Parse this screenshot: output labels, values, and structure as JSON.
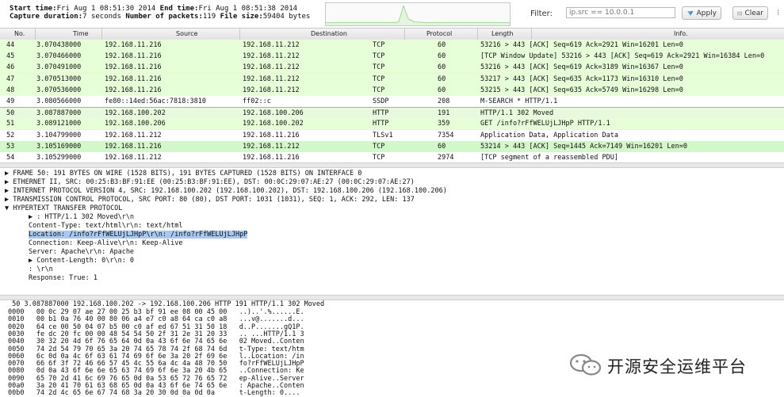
{
  "capture": {
    "start_label": "Start time:",
    "start_value": "Fri Aug  1 08:51:30 2014",
    "end_label": "End time:",
    "end_value": "Fri Aug  1 08:51:38 2014",
    "duration_label": "Capture duration:",
    "duration_value": "7 seconds",
    "packets_label": "Number of packets:",
    "packets_value": "119",
    "filesize_label": "File size:",
    "filesize_value": "59404 bytes"
  },
  "filter": {
    "label": "Filter:",
    "placeholder": "ip.src == 10.0.0.1",
    "apply_label": "Apply",
    "clear_label": "Clear"
  },
  "columns": [
    "No.",
    "Time",
    "Source",
    "Destination",
    "Protocol",
    "Length",
    "Info."
  ],
  "packets": [
    {
      "no": "44",
      "time": "3.070438000",
      "src": "192.168.11.216",
      "dst": "192.168.11.212",
      "proto": "TCP",
      "len": "60",
      "info": "53216 > 443 [ACK] Seq=619 Ack=2921 Win=16201 Len=0",
      "style": "green"
    },
    {
      "no": "45",
      "time": "3.070466000",
      "src": "192.168.11.216",
      "dst": "192.168.11.212",
      "proto": "TCP",
      "len": "60",
      "info": "[TCP Window Update] 53216 > 443 [ACK] Seq=619 Ack=2921 Win=16384 Len=0",
      "style": "green"
    },
    {
      "no": "46",
      "time": "3.070491000",
      "src": "192.168.11.216",
      "dst": "192.168.11.212",
      "proto": "TCP",
      "len": "60",
      "info": "53216 > 443 [ACK] Seq=619 Ack=3189 Win=16367 Len=0",
      "style": "green"
    },
    {
      "no": "47",
      "time": "3.070513000",
      "src": "192.168.11.216",
      "dst": "192.168.11.212",
      "proto": "TCP",
      "len": "60",
      "info": "53217 > 443 [ACK] Seq=635 Ack=1173 Win=16310 Len=0",
      "style": "green"
    },
    {
      "no": "48",
      "time": "3.070536000",
      "src": "192.168.11.216",
      "dst": "192.168.11.212",
      "proto": "TCP",
      "len": "60",
      "info": "53215 > 443 [ACK] Seq=635 Ack=5749 Win=16298 Len=0",
      "style": "green"
    },
    {
      "no": "49",
      "time": "3.080566000",
      "src": "fe80::14ed:56ac:7818:3810",
      "dst": "ff02::c",
      "proto": "SSDP",
      "len": "208",
      "info": "M-SEARCH * HTTP/1.1",
      "style": "white"
    },
    {
      "no": "50",
      "time": "3.087887000",
      "src": "192.168.100.202",
      "dst": "192.168.100.206",
      "proto": "HTTP",
      "len": "191",
      "info": "HTTP/1.1 302 Moved",
      "style": "sel"
    },
    {
      "no": "51",
      "time": "3.089121000",
      "src": "192.168.100.206",
      "dst": "192.168.100.202",
      "proto": "HTTP",
      "len": "359",
      "info": "GET /info?rFfWELUjLJHpP HTTP/1.1",
      "style": "green"
    },
    {
      "no": "52",
      "time": "3.104799000",
      "src": "192.168.11.212",
      "dst": "192.168.11.216",
      "proto": "TLSv1",
      "len": "7354",
      "info": "Application Data, Application Data",
      "style": "white"
    },
    {
      "no": "53",
      "time": "3.105169000",
      "src": "192.168.11.216",
      "dst": "192.168.11.212",
      "proto": "TCP",
      "len": "60",
      "info": "53214 > 443 [ACK] Seq=1445 Ack=7149 Win=16201 Len=0",
      "style": "green2"
    },
    {
      "no": "54",
      "time": "3.105299000",
      "src": "192.168.11.212",
      "dst": "192.168.11.216",
      "proto": "TCP",
      "len": "2974",
      "info": "[TCP segment of a reassembled PDU]",
      "style": "white"
    }
  ],
  "details": {
    "frame": "FRAME 50: 191 BYTES ON WIRE (1528 BITS), 191 BYTES CAPTURED (1528 BITS) ON INTERFACE 0",
    "ethernet": "ETHERNET II, SRC: 00:25:B3:BF:91:EE (00:25:B3:BF:91:EE), DST: 00:0C:29:07:AE:27 (00:0C:29:07:AE:27)",
    "ip": "INTERNET PROTOCOL VERSION 4, SRC: 192.168.100.202 (192.168.100.202), DST: 192.168.100.206 (192.168.100.206)",
    "tcp": "TRANSMISSION CONTROL PROTOCOL, SRC PORT: 80 (80), DST PORT: 1031 (1031), SEQ: 1, ACK: 292, LEN: 137",
    "http": "HYPERTEXT TRANSFER PROTOCOL",
    "http_children": [
      "▶ : HTTP/1.1 302 Moved\\r\\n",
      "Content-Type: text/html\\r\\n: text/html",
      "Location: /info?rFfWELUjLJHpP\\r\\n: /info?rFfWELUjLJHpP",
      "Connection: Keep-Alive\\r\\n: Keep-Alive",
      "Server: Apache\\r\\n: Apache",
      "▶ Content-Length: 0\\r\\n: 0",
      ": \\r\\n",
      "Response: True: 1"
    ]
  },
  "hex": {
    "summary": " 50 3.087887000 192.168.100.202 -> 192.168.100.206 HTTP 191 HTTP/1.1 302 Moved",
    "lines": [
      "0000   00 0c 29 07 ae 27 00 25 b3 bf 91 ee 08 00 45 00   ..)..'.%......E.",
      "0010   00 b1 0a 76 40 00 80 06 a4 e7 c0 a8 64 ca c0 a8   ...v@.......d...",
      "0020   64 ce 00 50 04 07 b5 00 c0 af ed 67 51 31 50 18   d..P.......gQ1P.",
      "0030   fe dc 20 fc 00 00 48 54 54 50 2f 31 2e 31 20 33   .. ...HTTP/1.1 3",
      "0040   30 32 20 4d 6f 76 65 64 0d 0a 43 6f 6e 74 65 6e   02 Moved..Conten",
      "0050   74 2d 54 79 70 65 3a 20 74 65 78 74 2f 68 74 6d   t-Type: text/htm",
      "0060   6c 0d 0a 4c 6f 63 61 74 69 6f 6e 3a 20 2f 69 6e   l..Location: /in",
      "0070   66 6f 3f 72 46 66 57 45 4c 55 6a 4c 4a 48 70 50   fo?rFfWELUjLJHpP",
      "0080   0d 0a 43 6f 6e 6e 65 63 74 69 6f 6e 3a 20 4b 65   ..Connection: Ke",
      "0090   65 70 2d 41 6c 69 76 65 0d 0a 53 65 72 76 65 72   ep-Alive..Server",
      "00a0   3a 20 41 70 61 63 68 65 0d 0a 43 6f 6e 74 65 6e   : Apache..Conten",
      "00b0   74 2d 4c 65 6e 67 74 68 3a 20 30 0d 0a 0d 0a      t-Length: 0...."
    ]
  },
  "watermark": {
    "text": "开源安全运维平台"
  },
  "colors": {
    "row_green": "#e6ffd9",
    "row_selected": "#e9f9dd",
    "highlight": "#a8c8f0",
    "spark_line": "#5dbb4a"
  }
}
